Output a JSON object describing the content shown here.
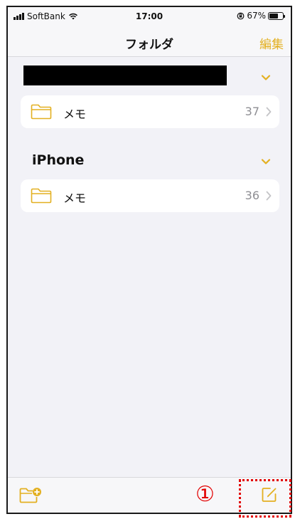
{
  "status_bar": {
    "carrier": "SoftBank",
    "time": "17:00",
    "battery_percent": "67%",
    "battery_level": 0.67
  },
  "nav": {
    "title": "フォルダ",
    "edit_label": "編集"
  },
  "sections": [
    {
      "title": "",
      "title_redacted": true,
      "folders": [
        {
          "label": "メモ",
          "count": "37"
        }
      ]
    },
    {
      "title": "iPhone",
      "title_redacted": false,
      "folders": [
        {
          "label": "メモ",
          "count": "36"
        }
      ]
    }
  ],
  "annotation": {
    "number": "①"
  },
  "colors": {
    "accent": "#e3b021",
    "background": "#f2f2f7",
    "annotation": "#e20000"
  },
  "icons": {
    "new_folder": "new-folder-icon",
    "compose": "compose-icon",
    "folder": "folder-icon",
    "chevron_down": "chevron-down-icon",
    "chevron_right": "chevron-right-icon"
  }
}
